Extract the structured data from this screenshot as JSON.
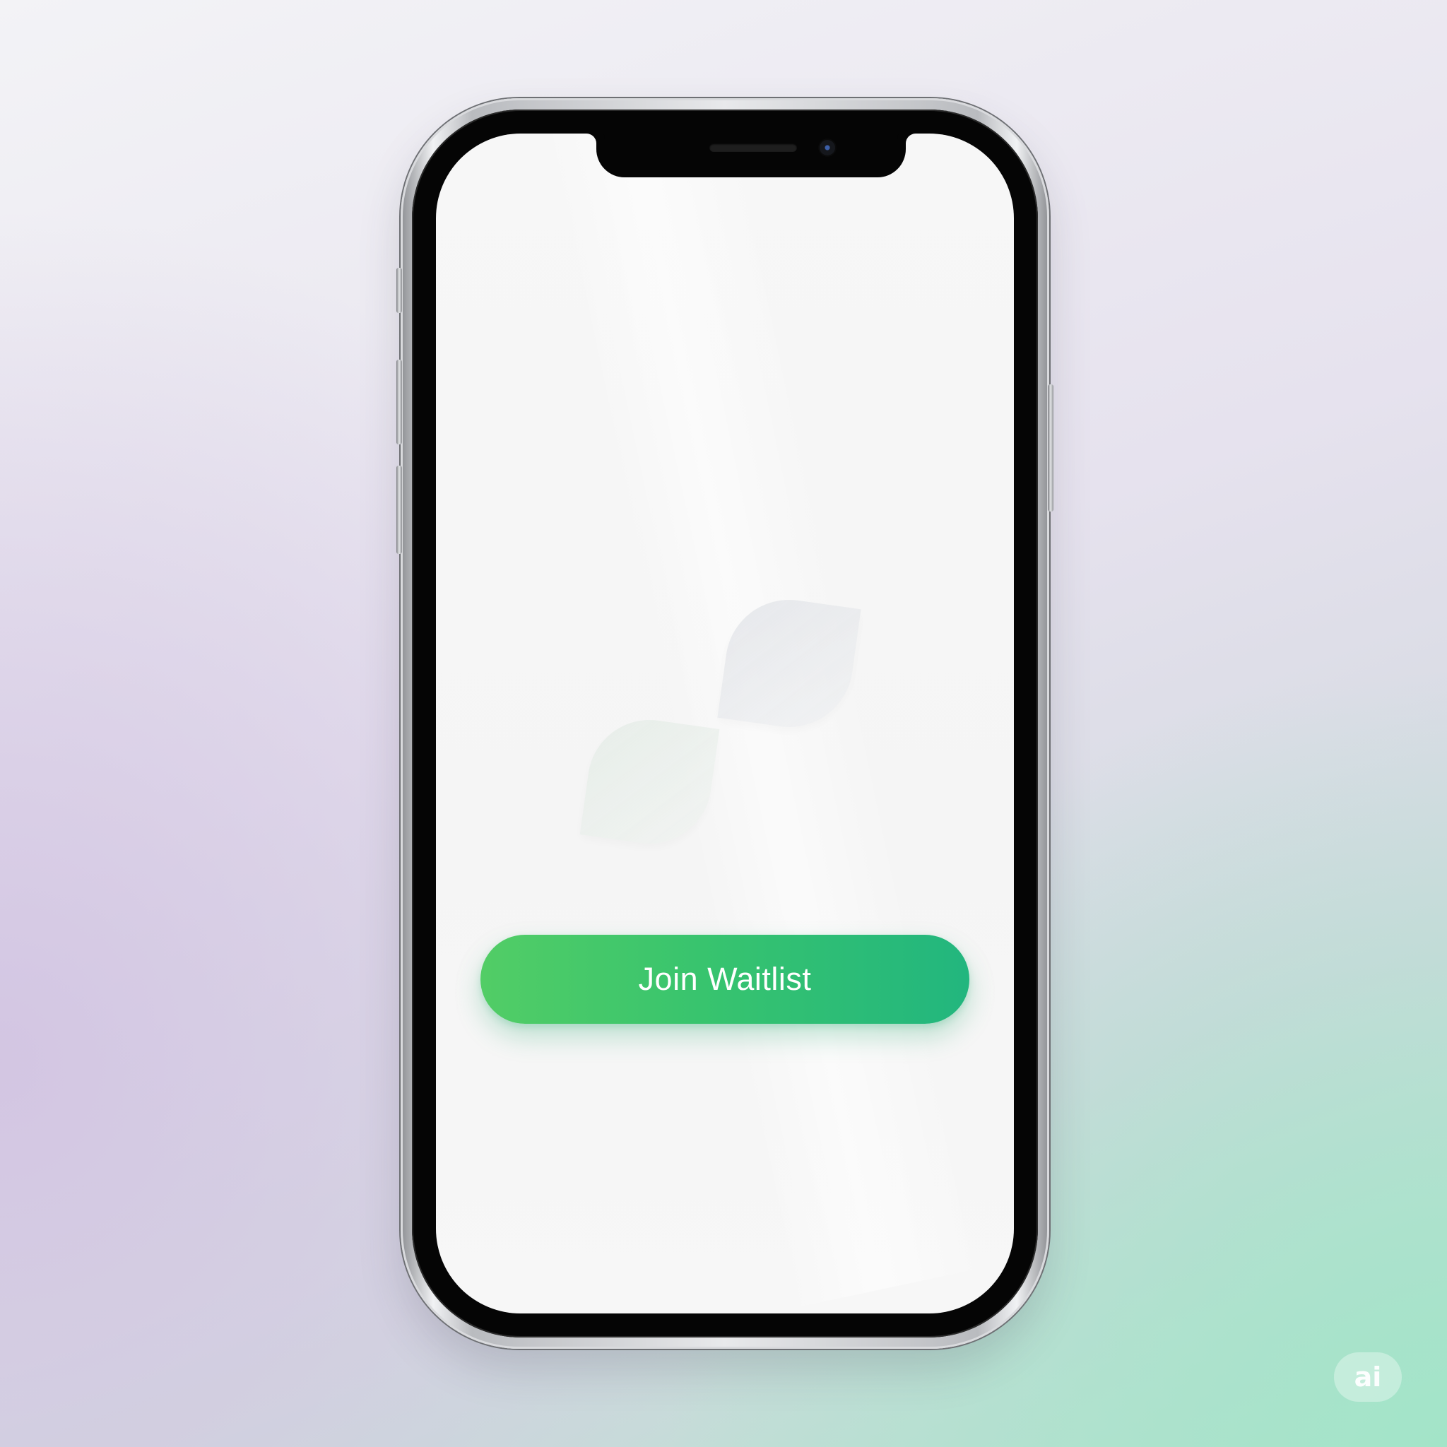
{
  "screen": {
    "cta_label": "Join Waitlist"
  },
  "badge": {
    "label": "ai"
  },
  "colors": {
    "cta_start": "#52cd66",
    "cta_end": "#22b67e",
    "screen_bg": "#f7f7f7",
    "bezel": "#050505"
  },
  "icons": [
    "leaf-icon"
  ]
}
